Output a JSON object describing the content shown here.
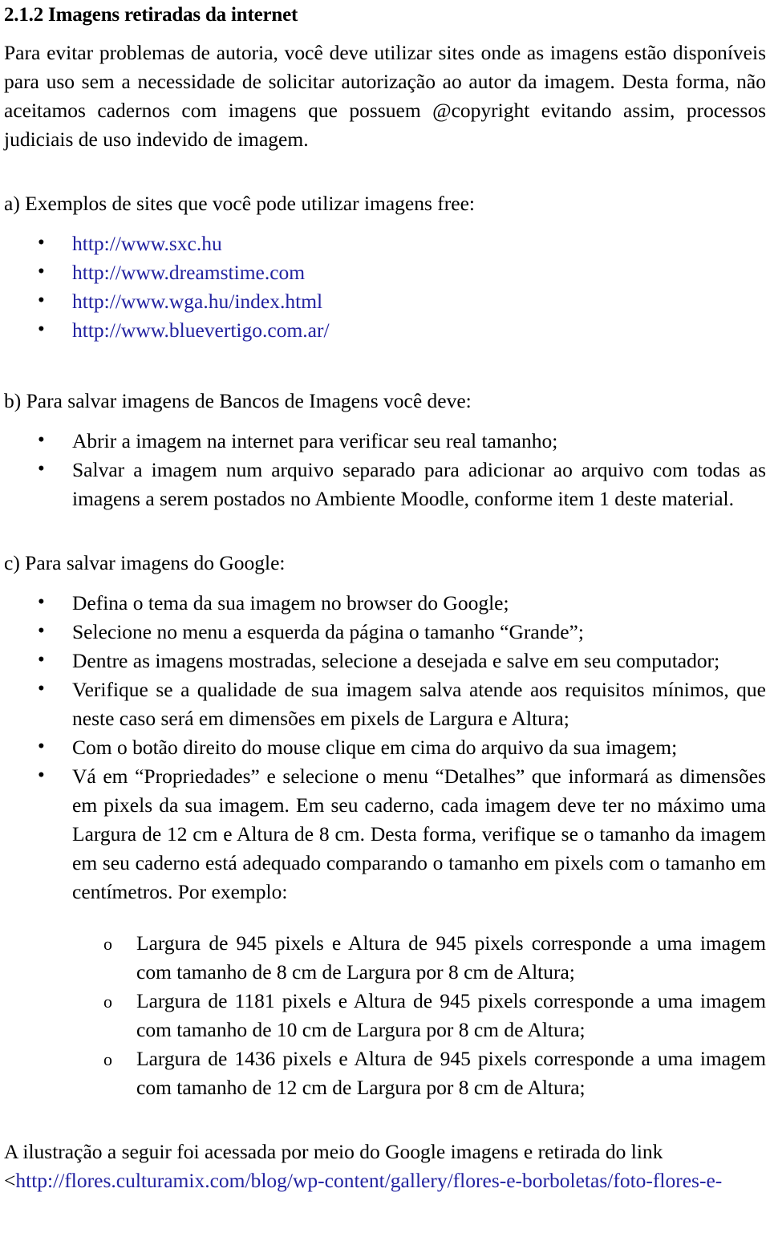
{
  "document": {
    "heading": "2.1.2 Imagens retiradas da internet",
    "intro_paragraph": "Para evitar problemas de autoria, você deve utilizar sites onde as imagens estão disponíveis para uso sem a necessidade de solicitar autorização ao autor da imagem. Desta forma, não aceitamos cadernos com imagens que possuem @copyright evitando assim, processos judiciais de uso indevido de imagem.",
    "section_a": {
      "label": "a) Exemplos de sites que você pode utilizar imagens free:",
      "links": [
        "http://www.sxc.hu",
        "http://www.dreamstime.com",
        "http://www.wga.hu/index.html",
        "http://www.bluevertigo.com.ar/"
      ]
    },
    "section_b": {
      "label": "b) Para salvar imagens de Bancos de Imagens você deve:",
      "items": [
        "Abrir a imagem na internet para verificar seu real tamanho;",
        "Salvar a imagem num arquivo separado para adicionar ao arquivo com todas as imagens a serem postados no Ambiente Moodle, conforme item 1 deste material."
      ]
    },
    "section_c": {
      "label": "c) Para salvar imagens do Google:",
      "items": [
        "Defina o tema da sua imagem no browser do Google;",
        "Selecione no menu  a esquerda da página o tamanho “Grande”;",
        "Dentre as imagens mostradas, selecione a desejada e salve em seu computador;",
        "Verifique se a qualidade de sua imagem salva atende aos requisitos mínimos, que neste caso será em dimensões em pixels de Largura e Altura;",
        "Com o botão direito do mouse clique em cima do arquivo da sua imagem;",
        "Vá em “Propriedades” e selecione o menu “Detalhes” que informará as dimensões em pixels da sua imagem. Em seu caderno, cada imagem deve ter no máximo uma Largura de 12 cm e Altura de 8 cm. Desta forma, verifique se o tamanho da imagem em seu caderno está adequado comparando o tamanho em pixels com o tamanho em centímetros. Por exemplo:"
      ],
      "examples": [
        "Largura de 945 pixels e Altura de 945 pixels corresponde a uma imagem com tamanho de 8 cm de Largura por 8 cm de Altura;",
        "Largura de 1181 pixels e Altura de 945 pixels corresponde a uma imagem com tamanho de 10 cm de Largura por 8 cm de Altura;",
        "Largura de 1436 pixels e Altura de 945 pixels corresponde a uma imagem com tamanho de 12 cm de Largura por 8 cm de Altura;"
      ]
    },
    "closing": {
      "text": "A ilustração a seguir foi acessada por meio do Google imagens e retirada do link",
      "bracket_open": "<",
      "url": "http://flores.culturamix.com/blog/wp-content/gallery/flores-e-borboletas/foto-flores-e-"
    },
    "colors": {
      "text": "#000000",
      "link": "#2222a0",
      "background": "#ffffff"
    }
  }
}
